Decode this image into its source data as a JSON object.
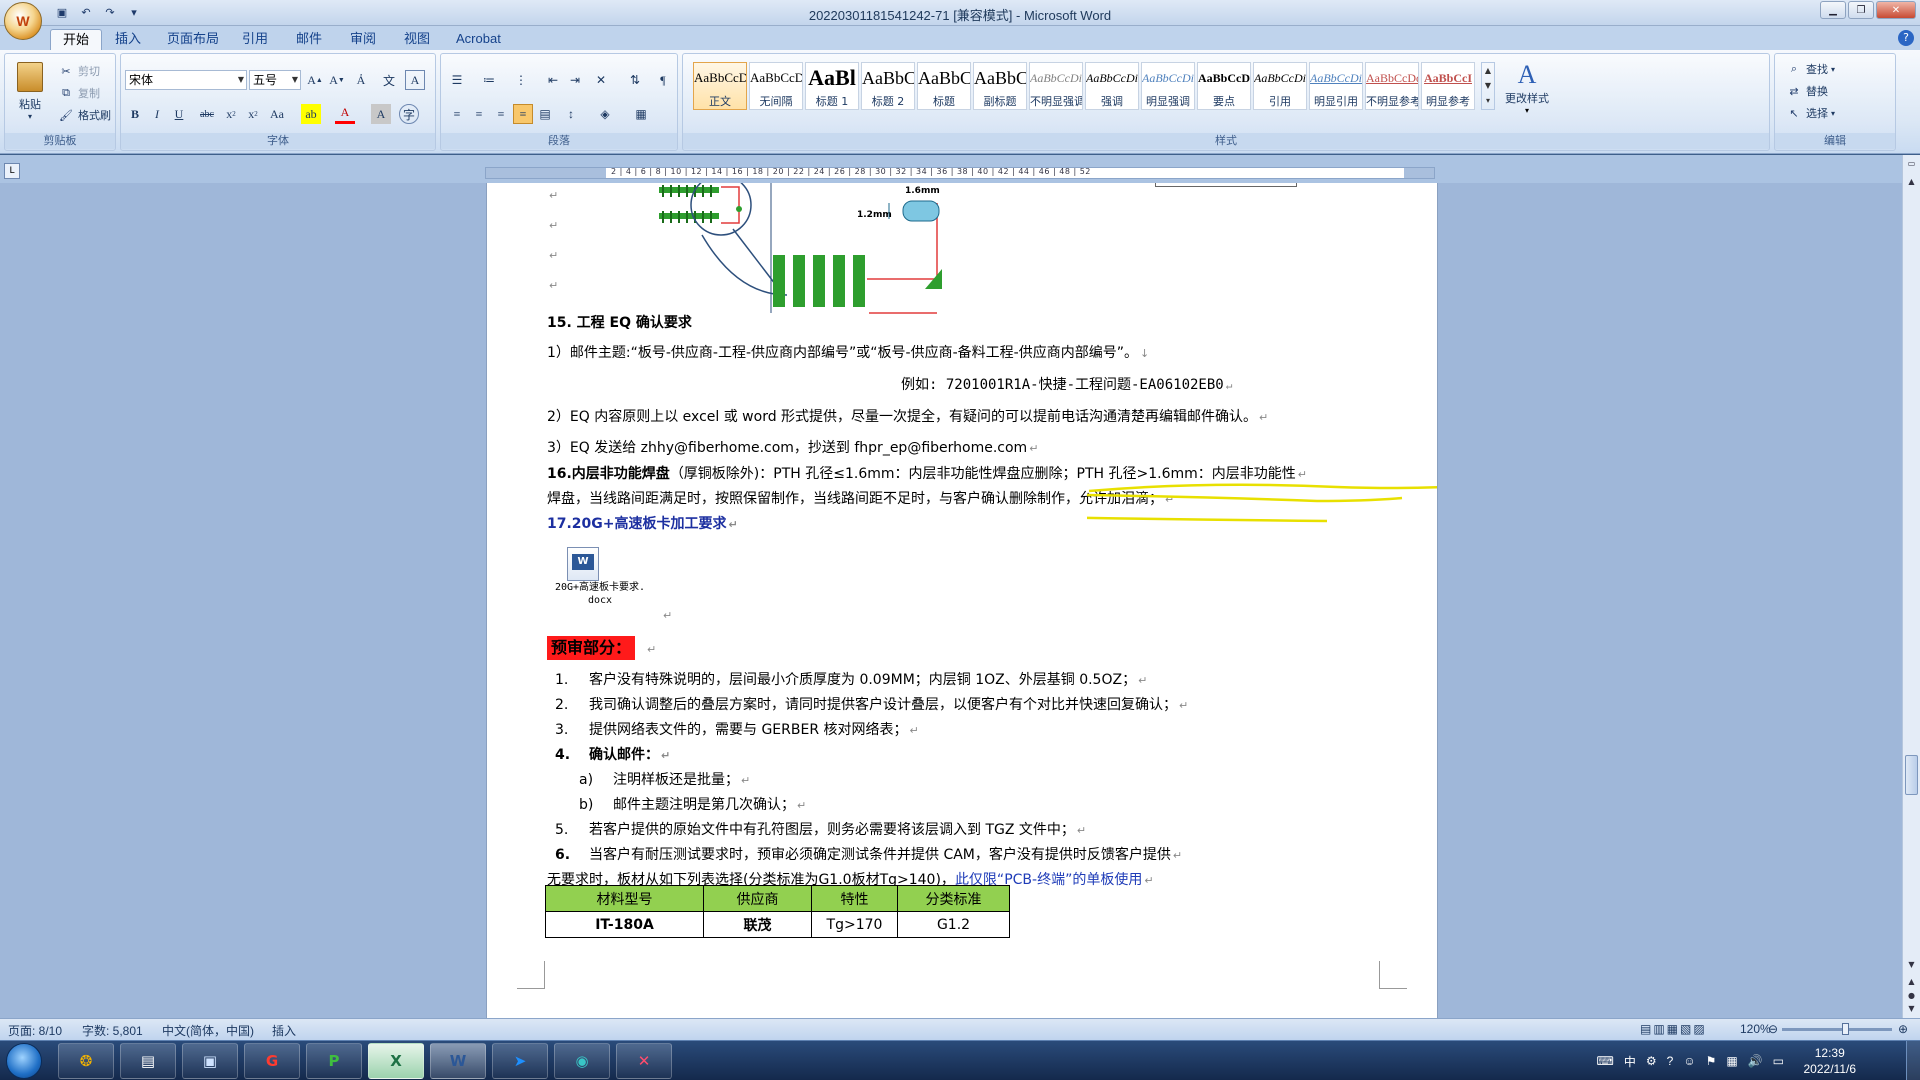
{
  "window": {
    "title": "20220301181541242-71 [兼容模式] - Microsoft Word",
    "office_button_label": "W"
  },
  "tabs": [
    "开始",
    "插入",
    "页面布局",
    "引用",
    "邮件",
    "审阅",
    "视图",
    "Acrobat"
  ],
  "ribbon": {
    "clipboard": {
      "paste": "粘贴",
      "cut": "剪切",
      "copy": "复制",
      "format_painter": "格式刷",
      "label": "剪贴板"
    },
    "font": {
      "name": "宋体",
      "size": "五号",
      "label": "字体"
    },
    "paragraph": {
      "label": "段落"
    },
    "styles": {
      "label": "样式",
      "items": [
        {
          "sample": "AaBbCcDc",
          "name": "正文"
        },
        {
          "sample": "AaBbCcDc",
          "name": "无间隔"
        },
        {
          "sample": "AaBl",
          "name": "标题 1"
        },
        {
          "sample": "AaBbC",
          "name": "标题 2"
        },
        {
          "sample": "AaBbC",
          "name": "标题"
        },
        {
          "sample": "AaBbC",
          "name": "副标题"
        },
        {
          "sample": "AaBbCcDi",
          "name": "不明显强调"
        },
        {
          "sample": "AaBbCcDi",
          "name": "强调"
        },
        {
          "sample": "AaBbCcDi",
          "name": "明显强调"
        },
        {
          "sample": "AaBbCcD",
          "name": "要点"
        },
        {
          "sample": "AaBbCcDi",
          "name": "引用"
        },
        {
          "sample": "AaBbCcDi",
          "name": "明显引用"
        },
        {
          "sample": "AaBbCcDd",
          "name": "不明显参考"
        },
        {
          "sample": "AaBbCcI",
          "name": "明显参考"
        }
      ],
      "change_styles": "更改样式"
    },
    "editing": {
      "find": "查找",
      "replace": "替换",
      "select": "选择",
      "label": "编辑"
    }
  },
  "ruler_numbers": "2 | 4 | 6 | 8 | 10 | 12 | 14 | 16 | 18 | 20 | 22 | 24 | 26 | 28 | 30 | 32 | 34 | 36 | 38 | 40 | 42 | 44 | 46 | 48 | 52",
  "doc": {
    "figure": {
      "label_16": "1.6mm",
      "label_12": "1.2mm"
    },
    "sec15_title": "15. 工程 EQ 确认要求",
    "sec15_item1": "1）邮件主题:“板号-供应商-工程-供应商内部编号”或“板号-供应商-备料工程-供应商内部编号”。",
    "sec15_example": "例如:      7201001R1A-快捷-工程问题-EA06102EB0",
    "sec15_item2": "2）EQ 内容原则上以 excel 或 word 形式提供，尽量一次提全，有疑问的可以提前电话沟通清楚再编辑邮件确认。",
    "sec15_item3": "3）EQ 发送给 zhhy@fiberhome.com，抄送到 fhpr_ep@fiberhome.com",
    "sec16_title": "16.内层非功能焊盘",
    "sec16_text1": "（厚铜板除外)：PTH 孔径≤1.6mm：内层非功能性焊盘应删除；PTH 孔径>1.6mm：内层非功能性",
    "sec16_text2": "焊盘，当线路间距满足时，按照保留制作，当线路间距不足时，与客户确认删除制作，允许加泪滴；",
    "sec17_title": "17.20G+高速板卡加工要求",
    "embed_file": {
      "line1": "20G+高速板卡要求.",
      "line2": "docx"
    },
    "precheck_title": "预审部分：",
    "items": [
      {
        "num": "1.",
        "text": "客户没有特殊说明的，层间最小介质厚度为 0.09MM；内层铜 1OZ、外层基铜 0.5OZ；"
      },
      {
        "num": "2.",
        "text": "我司确认调整后的叠层方案时，请同时提供客户设计叠层，以便客户有个对比并快速回复确认；"
      },
      {
        "num": "3.",
        "text": "提供网络表文件的，需要与 GERBER 核对网络表；"
      },
      {
        "num": "4.",
        "text": "确认邮件："
      },
      {
        "num": "a)",
        "text": "注明样板还是批量；"
      },
      {
        "num": "b)",
        "text": "邮件主题注明是第几次确认；"
      },
      {
        "num": "5.",
        "text": "若客户提供的原始文件中有孔符图层，则务必需要将该层调入到 TGZ 文件中；"
      },
      {
        "num": "6.",
        "text": "当客户有耐压测试要求时，预审必须确定测试条件并提供 CAM，客户没有提供时反馈客户提供"
      }
    ],
    "item6_cont": "无要求时，板材从如下列表选择(分类标准为G1.0板材Tg>140)，",
    "item6_cont_blue": "此仅限“PCB-终端”的单板使用",
    "table": {
      "headers": [
        "材料型号",
        "供应商",
        "特性",
        "分类标准"
      ],
      "rows": [
        [
          "IT-180A",
          "联茂",
          "Tg>170",
          "G1.2"
        ]
      ]
    }
  },
  "status": {
    "page": "页面: 8/10",
    "words": "字数: 5,801",
    "language": "中文(简体，中国)",
    "mode": "插入",
    "zoom": "120%"
  },
  "taskbar": {
    "ime": "中",
    "time": "12:39",
    "date": "2022/11/6"
  }
}
